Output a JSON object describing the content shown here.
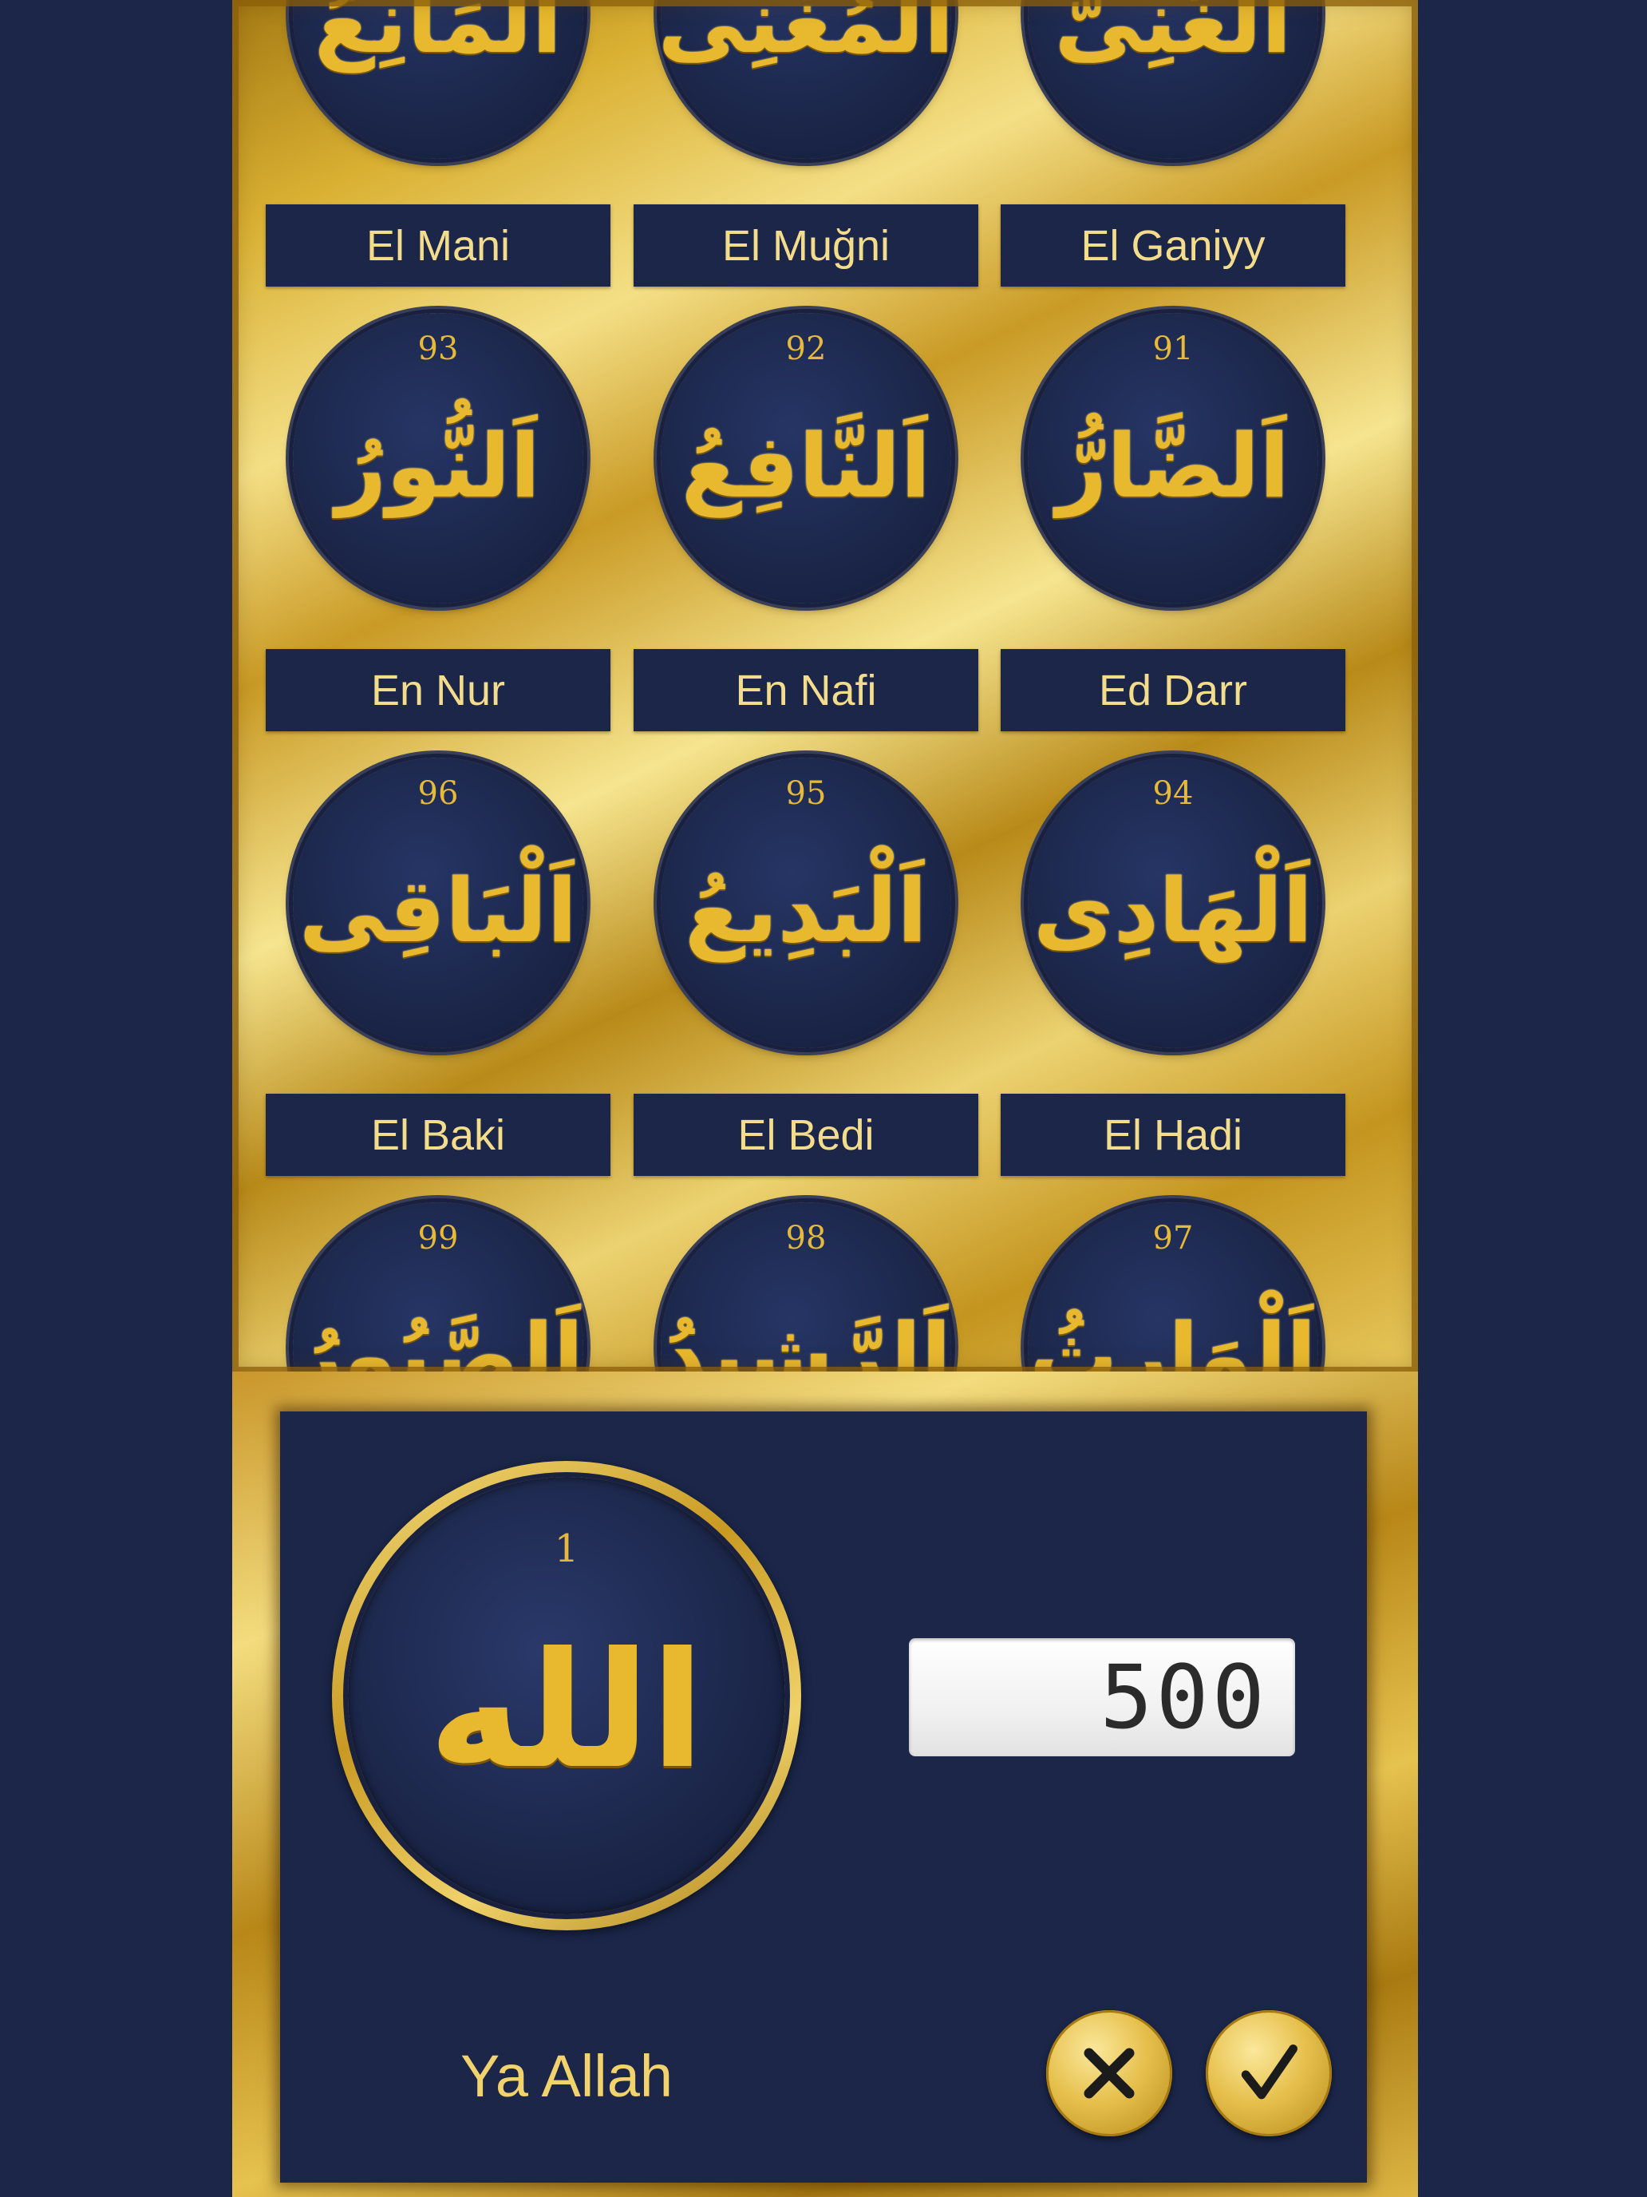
{
  "names_grid": {
    "rows": [
      {
        "items": [
          {
            "number": "",
            "arabic": "اَلْمَانِعُ",
            "name": "El Mani"
          },
          {
            "number": "",
            "arabic": "اَلْمُغْنِى",
            "name": "El Muğni"
          },
          {
            "number": "",
            "arabic": "اَلْغَنِىُّ",
            "name": "El Ganiyy"
          }
        ]
      },
      {
        "items": [
          {
            "number": "93",
            "arabic": "اَلنُّورُ",
            "name": "En Nur"
          },
          {
            "number": "92",
            "arabic": "اَلنَّافِعُ",
            "name": "En Nafi"
          },
          {
            "number": "91",
            "arabic": "اَلضَّارُّ",
            "name": "Ed Darr"
          }
        ]
      },
      {
        "items": [
          {
            "number": "96",
            "arabic": "اَلْبَاقِى",
            "name": "El Baki"
          },
          {
            "number": "95",
            "arabic": "اَلْبَدِيعُ",
            "name": "El Bedi"
          },
          {
            "number": "94",
            "arabic": "اَلْهَادِى",
            "name": "El Hadi"
          }
        ]
      },
      {
        "items": [
          {
            "number": "99",
            "arabic": "اَلصَّبُورُ",
            "name": ""
          },
          {
            "number": "98",
            "arabic": "اَلرَّشِيدُ",
            "name": ""
          },
          {
            "number": "97",
            "arabic": "اَلْوَارِثُ",
            "name": ""
          }
        ]
      }
    ]
  },
  "scrollbar": {
    "position_fraction": 0.79
  },
  "dialog": {
    "selected_number": "1",
    "selected_arabic": "الله",
    "selected_name": "Ya Allah",
    "counter_value": "500",
    "cancel_icon": "close-icon",
    "confirm_icon": "check-icon"
  },
  "colors": {
    "navy": "#1b2649",
    "gold": "#e8b92f",
    "label_text": "#f3dd8c",
    "scroll_thumb": "#ffd96a"
  }
}
